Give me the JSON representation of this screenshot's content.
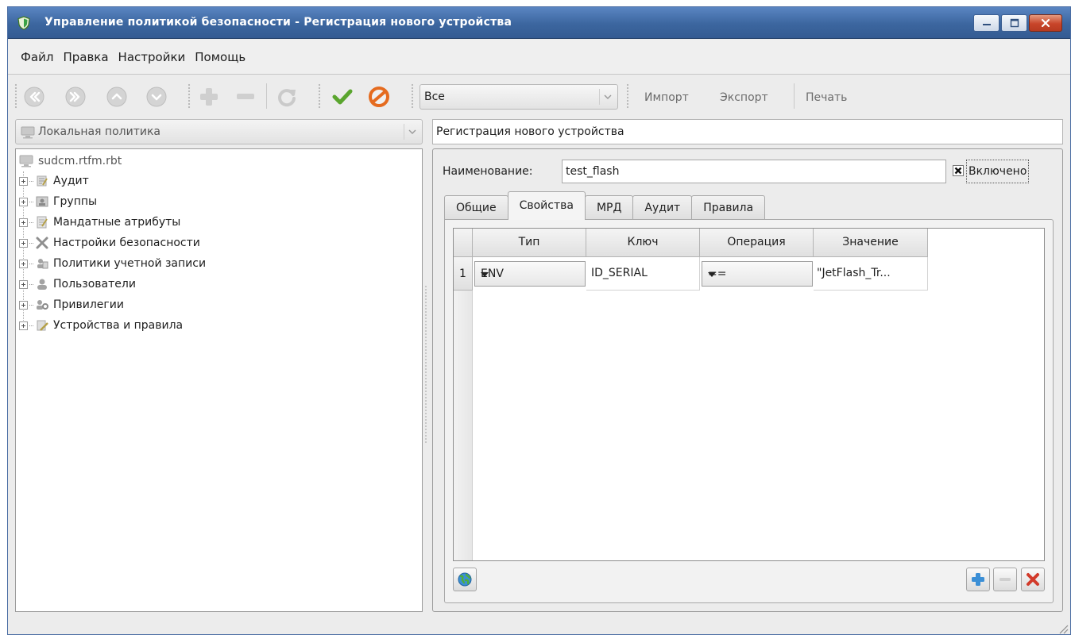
{
  "window": {
    "title": "Управление политикой безопасности - Регистрация нового устройства"
  },
  "menu": {
    "items": [
      "Файл",
      "Правка",
      "Настройки",
      "Помощь"
    ]
  },
  "toolbar": {
    "filter_value": "Все",
    "import_label": "Импорт",
    "export_label": "Экспорт",
    "print_label": "Печать",
    "icons": [
      "first-icon",
      "last-icon",
      "up-icon",
      "down-icon",
      "add-icon",
      "remove-icon",
      "refresh-icon",
      "apply-icon",
      "cancel-icon"
    ]
  },
  "left": {
    "policy_combo": "Локальная политика",
    "tree_root": "sudcm.rtfm.rbt",
    "tree_items": [
      {
        "label": "Аудит",
        "icon": "audit-icon"
      },
      {
        "label": "Группы",
        "icon": "groups-icon"
      },
      {
        "label": "Мандатные атрибуты",
        "icon": "mandatory-attributes-icon"
      },
      {
        "label": "Настройки безопасности",
        "icon": "security-settings-icon"
      },
      {
        "label": "Политики учетной записи",
        "icon": "account-policies-icon"
      },
      {
        "label": "Пользователи",
        "icon": "users-icon"
      },
      {
        "label": "Привилегии",
        "icon": "privileges-icon"
      },
      {
        "label": "Устройства и правила",
        "icon": "devices-rules-icon"
      }
    ]
  },
  "right": {
    "header": "Регистрация нового устройства",
    "name_label": "Наименование:",
    "name_value": "test_flash",
    "enabled_label": "Включено",
    "enabled_checked": true,
    "tabs": [
      {
        "label": "Общие",
        "active": false
      },
      {
        "label": "Свойства",
        "active": true
      },
      {
        "label": "МРД",
        "active": false
      },
      {
        "label": "Аудит",
        "active": false
      },
      {
        "label": "Правила",
        "active": false
      }
    ],
    "table": {
      "columns": [
        "Тип",
        "Ключ",
        "Операция",
        "Значение"
      ],
      "rows": [
        {
          "index": "1",
          "type": "ENV",
          "key": "ID_SERIAL",
          "operation": "==",
          "value": "\"JetFlash_Tr..."
        }
      ]
    }
  },
  "colors": {
    "titlebar": "#3c669f",
    "add_button": "#3b8fd6",
    "delete_button": "#d23a2a",
    "apply_check": "#5aa52e",
    "cancel_sign": "#e56b1f"
  }
}
